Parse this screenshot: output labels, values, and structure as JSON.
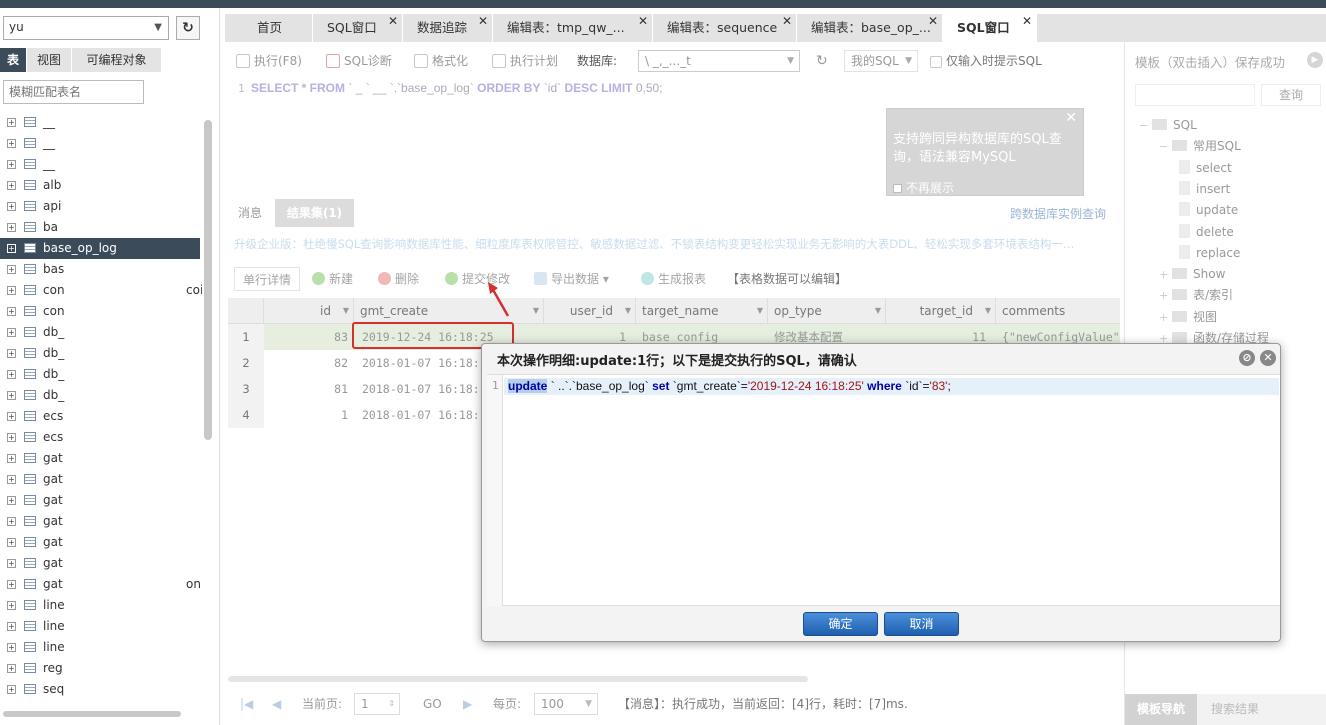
{
  "left_panel": {
    "db_select_value": "yu",
    "object_tabs": [
      "表",
      "视图",
      "可编程对象"
    ],
    "search_placeholder": "模糊匹配表名",
    "tables": [
      {
        "name": "__",
        "tail": ""
      },
      {
        "name": "__",
        "tail": ""
      },
      {
        "name": "__",
        "tail": ""
      },
      {
        "name": "alb",
        "tail": ""
      },
      {
        "name": "api",
        "tail": ""
      },
      {
        "name": "ba",
        "tail": ""
      },
      {
        "name": "base_op_log",
        "tail": "",
        "selected": true
      },
      {
        "name": "bas",
        "tail": ""
      },
      {
        "name": "con",
        "tail": "coi"
      },
      {
        "name": "con",
        "tail": ""
      },
      {
        "name": "db_",
        "tail": ""
      },
      {
        "name": "db_",
        "tail": ""
      },
      {
        "name": "db_",
        "tail": ""
      },
      {
        "name": "db_",
        "tail": ""
      },
      {
        "name": "ecs",
        "tail": ""
      },
      {
        "name": "ecs",
        "tail": ""
      },
      {
        "name": "gat",
        "tail": ""
      },
      {
        "name": "gat",
        "tail": ""
      },
      {
        "name": "gat",
        "tail": ""
      },
      {
        "name": "gat",
        "tail": ""
      },
      {
        "name": "gat",
        "tail": ""
      },
      {
        "name": "gat",
        "tail": ""
      },
      {
        "name": "gat",
        "tail": "on"
      },
      {
        "name": "line",
        "tail": ""
      },
      {
        "name": "line",
        "tail": ""
      },
      {
        "name": "line",
        "tail": ""
      },
      {
        "name": "reg",
        "tail": ""
      },
      {
        "name": "seq",
        "tail": ""
      }
    ]
  },
  "main_tabs": [
    {
      "label": "首页",
      "closable": false
    },
    {
      "label": "SQL窗口",
      "closable": true
    },
    {
      "label": "数据追踪",
      "closable": true
    },
    {
      "label": "编辑表：tmp_qw_...",
      "closable": true
    },
    {
      "label": "编辑表：sequence",
      "closable": true
    },
    {
      "label": "编辑表：base_op_...",
      "closable": true
    },
    {
      "label": "SQL窗口",
      "closable": true,
      "active": true
    }
  ],
  "toolbar": {
    "execute": "执行(F8)",
    "diagnose": "SQL诊断",
    "format": "格式化",
    "plan": "执行计划",
    "db_label": "数据库:",
    "db_value": "\\ _,_..._t",
    "my_sql": "我的SQL",
    "hint_only": "仅输入时提示SQL"
  },
  "editor": {
    "line": "1",
    "sql_kw1": "SELECT * FROM",
    "sql_mid": "` _ ` __ `.`base_op_log`",
    "sql_kw2": "ORDER BY",
    "sql_col": "`id`",
    "sql_kw3": "DESC  LIMIT",
    "sql_tail": "0,50;"
  },
  "tip": {
    "text": "支持跨同异构数据库的SQL查询，语法兼容MySQL",
    "checkbox": "不再展示"
  },
  "result_tabs": [
    "消息",
    "结果集(1)"
  ],
  "cross_db_link": "跨数据库实例查询",
  "promo": "升级企业版：杜绝慢SQL查询影响数据库性能、细粒度库表权限管控、敏感数据过滤、不锁表结构变更轻松实现业务无影响的大表DDL、轻松实现多套环境表结构一…",
  "grid_toolbar": {
    "row_detail": "单行详情",
    "new": "新建",
    "delete": "删除",
    "commit": "提交修改",
    "export": "导出数据",
    "report": "生成报表",
    "editable_note": "【表格数据可以编辑】"
  },
  "grid": {
    "columns": [
      "id",
      "gmt_create",
      "user_id",
      "target_name",
      "op_type",
      "target_id",
      "comments"
    ],
    "rows": [
      {
        "rn": "1",
        "id": "83",
        "gmt_create": "2019-12-24 16:18:25",
        "user_id": "1",
        "target_name": "base_config",
        "op_type": "修改基本配置",
        "target_id": "11",
        "comments": "{\"newConfigValue\""
      },
      {
        "rn": "2",
        "id": "82",
        "gmt_create": "2018-01-07 16:18:",
        "user_id": "",
        "target_name": "",
        "op_type": "",
        "target_id": "",
        "comments": ""
      },
      {
        "rn": "3",
        "id": "81",
        "gmt_create": "2018-01-07 16:18:",
        "user_id": "",
        "target_name": "",
        "op_type": "",
        "target_id": "",
        "comments": ""
      },
      {
        "rn": "4",
        "id": "1",
        "gmt_create": "2018-01-07 16:18:",
        "user_id": "",
        "target_name": "",
        "op_type": "",
        "target_id": "",
        "comments": ""
      }
    ]
  },
  "pager": {
    "current_label": "当前页:",
    "current_value": "1",
    "go": "GO",
    "per_page_label": "每页:",
    "per_page_value": "100",
    "message": "【消息】：执行成功，当前返回：[4]行，耗时：[7]ms."
  },
  "right_panel": {
    "title": "模板（双击插入）保存成功",
    "query_button": "查询",
    "tree": [
      {
        "label": "SQL",
        "type": "folder",
        "level": 0
      },
      {
        "label": "常用SQL",
        "type": "folder",
        "level": 1
      },
      {
        "label": "select",
        "type": "file",
        "level": 2
      },
      {
        "label": "insert",
        "type": "file",
        "level": 2
      },
      {
        "label": "update",
        "type": "file",
        "level": 2
      },
      {
        "label": "delete",
        "type": "file",
        "level": 2
      },
      {
        "label": "replace",
        "type": "file",
        "level": 2
      },
      {
        "label": "Show",
        "type": "folder",
        "level": 1
      },
      {
        "label": "表/索引",
        "type": "folder",
        "level": 1
      },
      {
        "label": "视图",
        "type": "folder",
        "level": 1
      },
      {
        "label": "函数/存储过程",
        "type": "folder",
        "level": 1
      }
    ],
    "bottom_tabs": [
      "模板导航",
      "搜索结果"
    ]
  },
  "dialog": {
    "title": "本次操作明细:update:1行；以下是提交执行的SQL，请确认",
    "line": "1",
    "sql_kw1": "update",
    "sql_tbl": "`          ..`.`base_op_log`",
    "sql_kw2": "set",
    "sql_col1": "`gmt_create`=",
    "sql_val1": "'2019-12-24 16:18:25'",
    "sql_kw3": "where",
    "sql_col2": "`id`=",
    "sql_val2": "'83'",
    "sql_end": ";",
    "confirm": "确定",
    "cancel": "取消"
  },
  "colors": {
    "accent_dark": "#3c4b5a",
    "button_blue": "#2c6fc2",
    "highlight_red": "#d4302e"
  }
}
